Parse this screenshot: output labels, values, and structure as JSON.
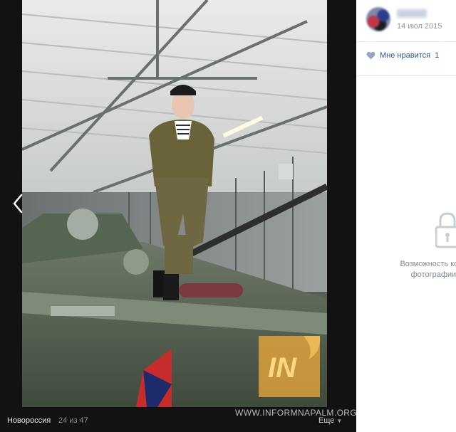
{
  "viewer": {
    "album": "Новороссия",
    "counter": "24 из 47",
    "watermark": "WWW.INFORMNAPALM.ORG",
    "logo_text": "IN",
    "more": "Еще",
    "prev_icon": "chevron-left-icon",
    "more_icon": "chevron-down-icon"
  },
  "panel": {
    "date": "14 июл 2015",
    "like_label": "Мне нравится",
    "like_count": "1",
    "like_icon": "heart-icon",
    "closed_icon": "lock-icon",
    "closed_text_line1": "Возможность комме",
    "closed_text_line2": "фотографии о",
    "colors": {
      "link": "#2a5885",
      "muted": "#8f96a0",
      "viewer_bg": "#121212"
    }
  }
}
